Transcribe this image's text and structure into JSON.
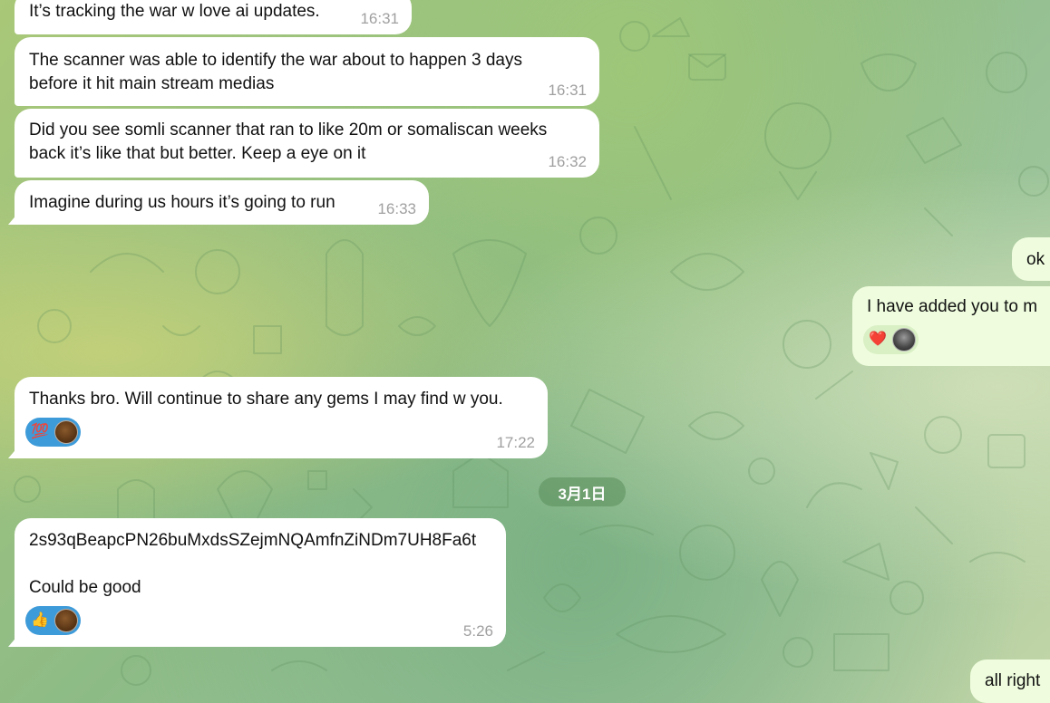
{
  "chat": {
    "messages": [
      {
        "id": "m1",
        "direction": "in",
        "text": "It’s tracking the war w love ai updates.",
        "time": "16:31"
      },
      {
        "id": "m2",
        "direction": "in",
        "text": "The scanner was able to identify the war about to happen 3 days\nbefore it hit main stream medias",
        "time": "16:31"
      },
      {
        "id": "m3",
        "direction": "in",
        "text": "Did you see somli scanner that ran to like 20m or somaliscan weeks\nback it’s like that but better. Keep a eye on it",
        "time": "16:32"
      },
      {
        "id": "m4",
        "direction": "in",
        "text": "Imagine during us hours it’s going to run",
        "time": "16:33"
      },
      {
        "id": "m5",
        "direction": "out",
        "text": "ok"
      },
      {
        "id": "m6",
        "direction": "out",
        "text": "I have added you to m",
        "reactions": [
          "heart-emoji",
          "avatar"
        ]
      },
      {
        "id": "m7",
        "direction": "in",
        "text": "Thanks bro. Will continue to share any gems I may find w you.",
        "time": "17:22",
        "reactions": [
          "hundred-emoji",
          "avatar"
        ]
      },
      {
        "id": "m8",
        "direction": "in",
        "text": "2s93qBeapcPN26buMxdsSZejmNQAmfnZiNDm7UH8Fa6t\n\nCould be good",
        "time": "5:26",
        "reactions": [
          "thumbs-up-emoji",
          "avatar"
        ]
      },
      {
        "id": "m9",
        "direction": "out",
        "text": "all right"
      }
    ],
    "date_separator": "3月1日",
    "emoji": {
      "heart": "❤️",
      "hundred": "💯",
      "thumbs_up": "👍"
    }
  },
  "colors": {
    "incoming_bubble": "#ffffff",
    "outgoing_bubble": "#effdde",
    "reaction_in": "#3e9bd9",
    "reaction_out": "#d9efc4",
    "timestamp": "#a0a0a0",
    "date_pill": "#5a8c5a"
  }
}
